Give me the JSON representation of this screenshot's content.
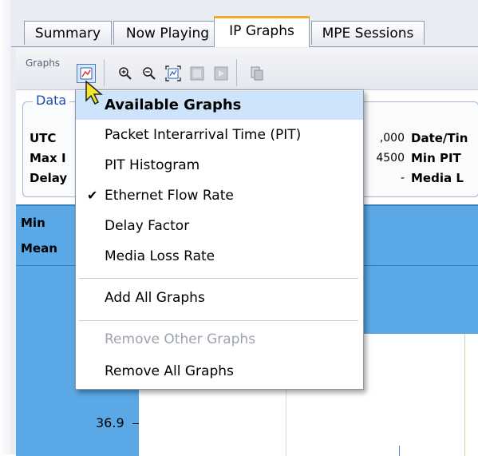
{
  "tabs": [
    {
      "label": "Summary"
    },
    {
      "label": "Now Playing"
    },
    {
      "label": "IP Graphs"
    },
    {
      "label": "MPE Sessions"
    }
  ],
  "toolbar": {
    "graphs_label": "Graphs",
    "icons": [
      "graph-menu-icon",
      "zoom-in-icon",
      "zoom-out-icon",
      "zoom-fit-icon",
      "pan-icon",
      "export-icon",
      "print-icon"
    ]
  },
  "data_panel": {
    "legend": "Data",
    "left_labels": [
      "UTC",
      "Max I",
      "Delay"
    ],
    "values": [
      ",000",
      "4500",
      "-"
    ],
    "right_labels": [
      "Date/Tin",
      "Min PIT",
      "Media L"
    ]
  },
  "graph_panel": {
    "stats": [
      "Min",
      "Mean"
    ],
    "y_tick": "36.9"
  },
  "menu": {
    "header": "Available Graphs",
    "items": [
      {
        "label": "Packet Interarrival Time (PIT)",
        "checked": false,
        "enabled": true
      },
      {
        "label": "PIT Histogram",
        "checked": false,
        "enabled": true
      },
      {
        "label": "Ethernet Flow Rate",
        "checked": true,
        "enabled": true
      },
      {
        "label": "Delay Factor",
        "checked": false,
        "enabled": true
      },
      {
        "label": "Media Loss Rate",
        "checked": false,
        "enabled": true
      }
    ],
    "add_all": "Add All Graphs",
    "remove_other": "Remove Other Graphs",
    "remove_all": "Remove All Graphs",
    "check_glyph": "✔"
  },
  "colors": {
    "active_tab_accent": "#f6a623",
    "menu_header_bg": "#cde4fa",
    "graph_panel_bg": "#5aa9e6"
  }
}
